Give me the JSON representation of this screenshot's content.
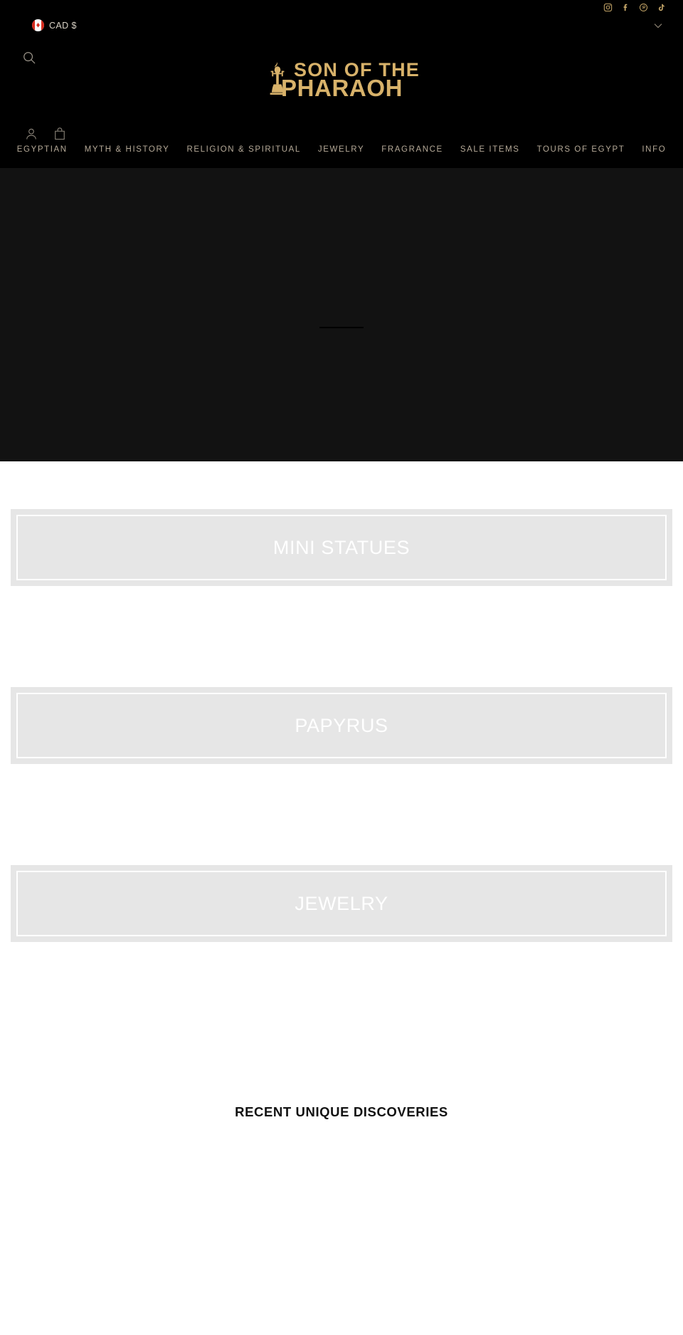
{
  "header": {
    "currency": {
      "icon": "canada-flag-icon",
      "label": "CAD $",
      "leaf_glyph": "♦"
    },
    "chevron_icon": "chevron-down-icon",
    "search_icon": "search-icon",
    "account_icon": "account-icon",
    "cart_icon": "shopping-bag-icon",
    "social": [
      {
        "name": "instagram-icon",
        "label": "Instagram"
      },
      {
        "name": "facebook-icon",
        "label": "Facebook"
      },
      {
        "name": "pinterest-icon",
        "label": "Pinterest"
      },
      {
        "name": "tiktok-icon",
        "label": "TikTok"
      }
    ],
    "logo": {
      "line1": "SON OF THE",
      "line2": "PHARAOH",
      "mark": "pharaoh-statue-icon",
      "color": "#d8b26a"
    },
    "nav": [
      {
        "label": "EGYPTIAN"
      },
      {
        "label": "MYTH & HISTORY"
      },
      {
        "label": "RELIGION & SPIRITUAL"
      },
      {
        "label": "JEWELRY"
      },
      {
        "label": "FRAGRANCE"
      },
      {
        "label": "SALE ITEMS"
      },
      {
        "label": "TOURS OF EGYPT"
      },
      {
        "label": "INFO"
      }
    ]
  },
  "hero": {
    "background_color": "#121212"
  },
  "collections": [
    {
      "title": "MINI STATUES"
    },
    {
      "title": "PAPYRUS"
    },
    {
      "title": "JEWELRY"
    }
  ],
  "recent": {
    "heading": "RECENT UNIQUE DISCOVERIES"
  }
}
